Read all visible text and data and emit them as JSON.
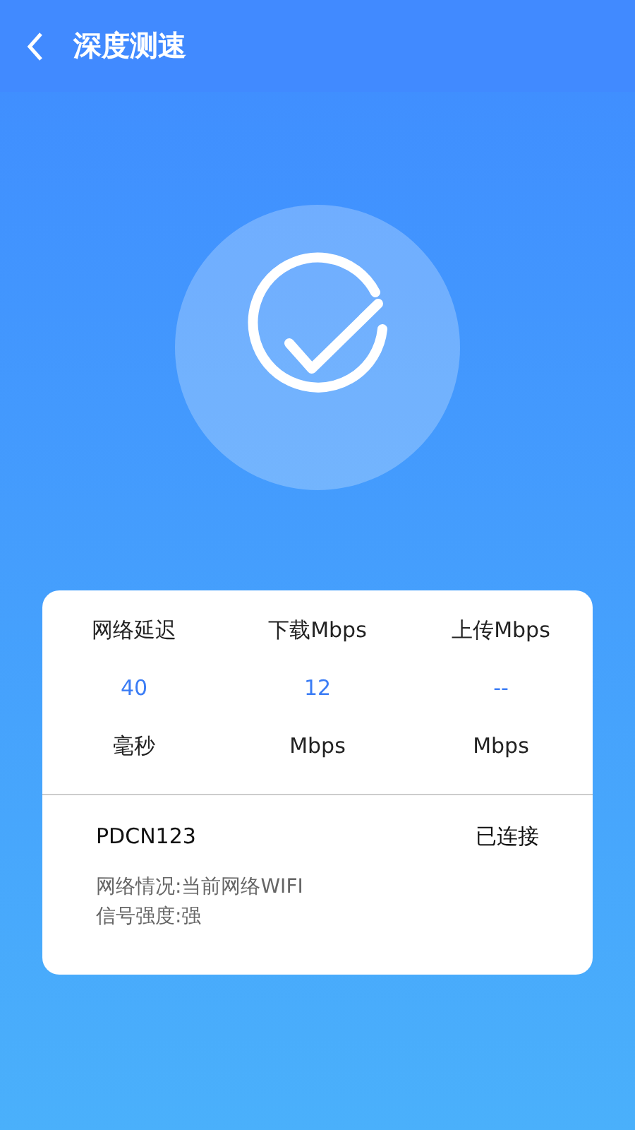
{
  "header": {
    "title": "深度测速"
  },
  "metrics": [
    {
      "label": "网络延迟",
      "value": "40",
      "unit": "毫秒"
    },
    {
      "label": "下载Mbps",
      "value": "12",
      "unit": "Mbps"
    },
    {
      "label": "上传Mbps",
      "value": "--",
      "unit": "Mbps"
    }
  ],
  "network": {
    "name": "PDCN123",
    "state": "已连接",
    "details": [
      "网络情况:当前网络WIFI",
      "信号强度:强"
    ]
  }
}
